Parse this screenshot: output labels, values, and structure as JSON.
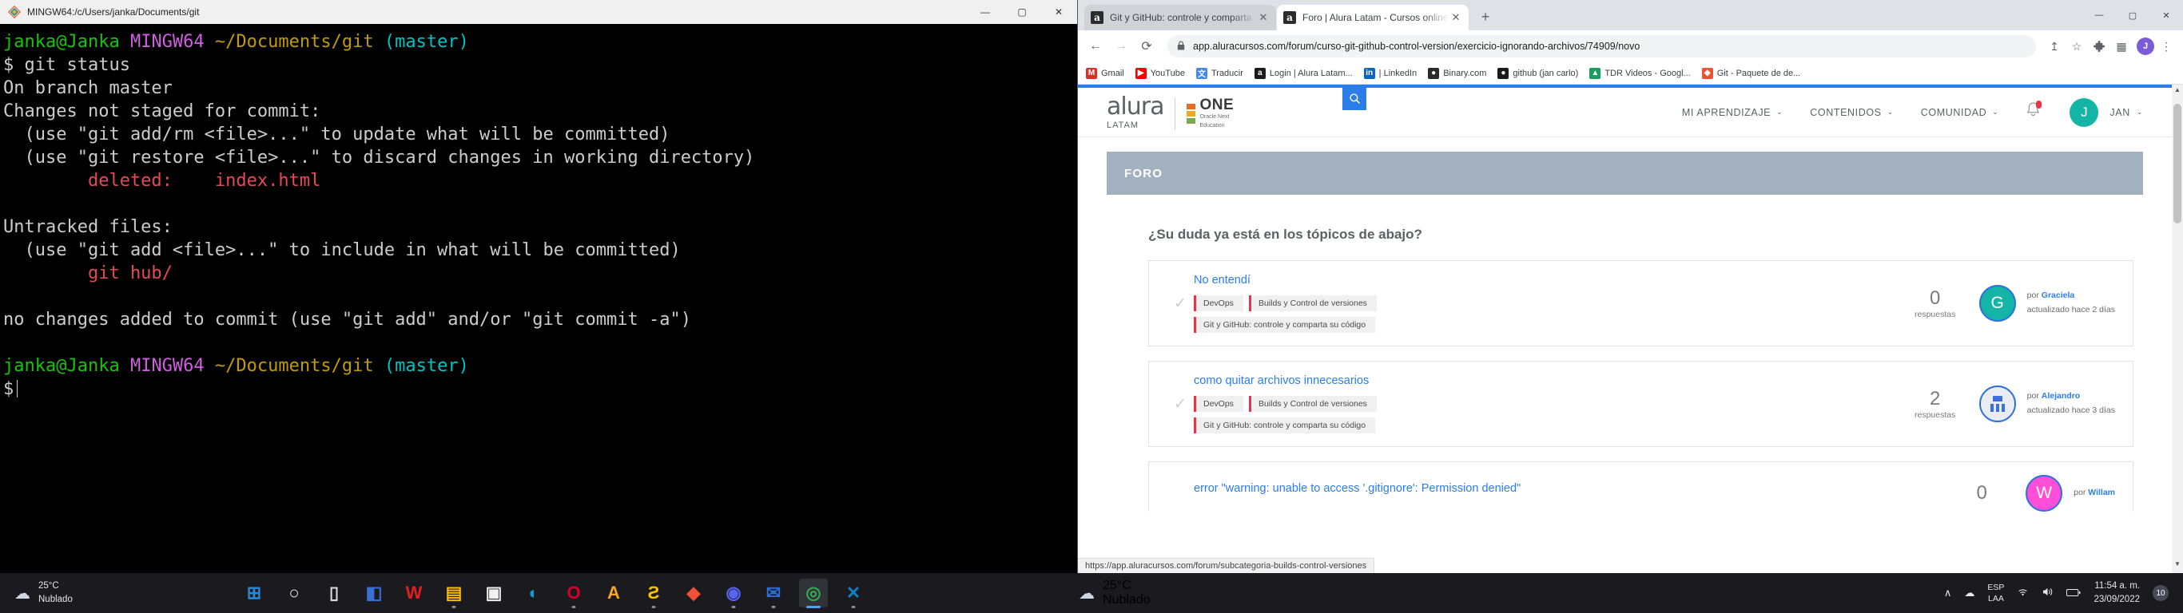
{
  "terminal": {
    "window_title": "MINGW64:/c/Users/janka/Documents/git",
    "controls": {
      "minimize": "—",
      "maximize": "▢",
      "close": "✕"
    },
    "lines": [
      {
        "segments": [
          {
            "text": "janka@Janka",
            "color": "green"
          },
          {
            "text": " MINGW64 ",
            "color": "purple"
          },
          {
            "text": "~/Documents/git",
            "color": "yellow"
          },
          {
            "text": " (master)",
            "color": "cyan"
          }
        ]
      },
      {
        "segments": [
          {
            "text": "$ git status",
            "color": "white"
          }
        ]
      },
      {
        "segments": [
          {
            "text": "On branch master",
            "color": "white"
          }
        ]
      },
      {
        "segments": [
          {
            "text": "Changes not staged for commit:",
            "color": "white"
          }
        ]
      },
      {
        "segments": [
          {
            "text": "  (use \"git add/rm <file>...\" to update what will be committed)",
            "color": "white"
          }
        ]
      },
      {
        "segments": [
          {
            "text": "  (use \"git restore <file>...\" to discard changes in working directory)",
            "color": "white"
          }
        ]
      },
      {
        "segments": [
          {
            "text": "        deleted:    index.html",
            "color": "red"
          }
        ]
      },
      {
        "segments": [
          {
            "text": "",
            "color": "white"
          }
        ]
      },
      {
        "segments": [
          {
            "text": "Untracked files:",
            "color": "white"
          }
        ]
      },
      {
        "segments": [
          {
            "text": "  (use \"git add <file>...\" to include in what will be committed)",
            "color": "white"
          }
        ]
      },
      {
        "segments": [
          {
            "text": "        git hub/",
            "color": "red"
          }
        ]
      },
      {
        "segments": [
          {
            "text": "",
            "color": "white"
          }
        ]
      },
      {
        "segments": [
          {
            "text": "no changes added to commit (use \"git add\" and/or \"git commit -a\")",
            "color": "white"
          }
        ]
      },
      {
        "segments": [
          {
            "text": "",
            "color": "white"
          }
        ]
      },
      {
        "segments": [
          {
            "text": "janka@Janka",
            "color": "green"
          },
          {
            "text": " MINGW64 ",
            "color": "purple"
          },
          {
            "text": "~/Documents/git",
            "color": "yellow"
          },
          {
            "text": " (master)",
            "color": "cyan"
          }
        ]
      },
      {
        "segments": [
          {
            "text": "$",
            "color": "white"
          }
        ],
        "cursor": true
      }
    ]
  },
  "browser": {
    "tabs": [
      {
        "favicon_letter": "a",
        "title": "Git y GitHub: controle y comparta",
        "close": "✕",
        "active": false
      },
      {
        "favicon_letter": "a",
        "title": "Foro | Alura Latam - Cursos online",
        "close": "✕",
        "active": true
      }
    ],
    "new_tab_label": "+",
    "window_controls": {
      "minimize": "—",
      "maximize": "▢",
      "close": "✕"
    },
    "toolbar": {
      "back": "←",
      "forward": "→",
      "reload": "⟳",
      "lock_icon": "lock-icon",
      "url": "app.aluracursos.com/forum/curso-git-github-control-version/exercicio-ignorando-archivos/74909/novo",
      "share_icon": "↥",
      "star_icon": "☆",
      "extensions_icon": "🧩",
      "apps_icon": "▦",
      "profile_letter": "J",
      "menu_icon": "⋮"
    },
    "bookmarks": [
      {
        "label": "Gmail",
        "glyph": "M",
        "color": "#d93025"
      },
      {
        "label": "YouTube",
        "glyph": "▶",
        "color": "#ff0000"
      },
      {
        "label": "Traducir",
        "glyph": "文",
        "color": "#4285f4"
      },
      {
        "label": "Login | Alura Latam...",
        "glyph": "a",
        "color": "#1b1b1b"
      },
      {
        "label": "| LinkedIn",
        "glyph": "in",
        "color": "#0a66c2"
      },
      {
        "label": "Binary.com",
        "glyph": "●",
        "color": "#2a2a2a"
      },
      {
        "label": "github (jan carlo)",
        "glyph": "●",
        "color": "#1b1b1b"
      },
      {
        "label": "TDR Videos - Googl...",
        "glyph": "▲",
        "color": "#1a9e5d"
      },
      {
        "label": "Git - Paquete de de...",
        "glyph": "◆",
        "color": "#f05033"
      }
    ],
    "status_bubble": "https://app.aluracursos.com/forum/subcategoria-builds-control-versiones"
  },
  "alura": {
    "logo": {
      "brand": "alura",
      "region": "LATAM",
      "one": "ONE",
      "one_sub_1": "Oracle Next",
      "one_sub_2": "Education"
    },
    "search_icon": "search-icon",
    "nav": [
      {
        "label": "MI APRENDIZAJE",
        "caret": "⌄"
      },
      {
        "label": "CONTENIDOS",
        "caret": "⌄"
      },
      {
        "label": "COMUNIDAD",
        "caret": "⌄"
      }
    ],
    "notifications_icon": "bell-icon",
    "user": {
      "initial": "J",
      "name": "JAN",
      "caret": "⌄",
      "avatar_color": "#14b5a6"
    },
    "band_title": "FORO",
    "question": "¿Su duda ya está en los tópicos de abajo?",
    "topics": [
      {
        "title": "No entendí",
        "tags": [
          "DevOps",
          "Builds y Control de versiones",
          "Git y GitHub: controle y comparta su código"
        ],
        "replies_count": "0",
        "replies_label": "respuestas",
        "avatar_initial": "G",
        "avatar_color": "#14b5a6",
        "by_label": "por",
        "author": "Graciela",
        "updated": "actualizado hace 2 días"
      },
      {
        "title": "como quitar archivos innecesarios",
        "tags": [
          "DevOps",
          "Builds y Control de versiones",
          "Git y GitHub: controle y comparta su código"
        ],
        "replies_count": "2",
        "replies_label": "respuestas",
        "avatar_initial": "",
        "avatar_color": "#e9ecf2",
        "by_label": "por",
        "author": "Alejandro",
        "updated": "actualizado hace 3 días"
      },
      {
        "title": "error \"warning: unable to access '.gitignore': Permission denied\"",
        "tags": [],
        "replies_count": "0",
        "replies_label": "",
        "avatar_initial": "W",
        "avatar_color": "#ff4fd8",
        "by_label": "por",
        "author": "Willam",
        "updated": ""
      }
    ]
  },
  "taskbar": {
    "weather_left": {
      "temp": "25°C",
      "desc": "Nublado"
    },
    "weather_right": {
      "temp": "25°C",
      "desc": "Nublado"
    },
    "apps": [
      {
        "name": "start-button",
        "glyph": "⊞",
        "color": "#2b88d8"
      },
      {
        "name": "search-button",
        "glyph": "○",
        "color": "#e8e8e8"
      },
      {
        "name": "task-view-button",
        "glyph": "▯",
        "color": "#dcdcdc"
      },
      {
        "name": "widgets-button",
        "glyph": "◧",
        "color": "#3a6fd8"
      },
      {
        "name": "wondershare-app",
        "glyph": "W",
        "color": "#e02020"
      },
      {
        "name": "file-explorer",
        "glyph": "▤",
        "color": "#ffb900"
      },
      {
        "name": "microsoft-store",
        "glyph": "▣",
        "color": "#f2f2f2"
      },
      {
        "name": "microsoft-edge",
        "glyph": "◐",
        "color": "#0f9ed5"
      },
      {
        "name": "opera-browser",
        "glyph": "O",
        "color": "#d6002a"
      },
      {
        "name": "adobe-app",
        "glyph": "A",
        "color": "#f5a623"
      },
      {
        "name": "sublime-text",
        "glyph": "Ƨ",
        "color": "#f7c600"
      },
      {
        "name": "git-bash",
        "glyph": "◆",
        "color": "#f05033"
      },
      {
        "name": "discord-app",
        "glyph": "◉",
        "color": "#5865f2"
      },
      {
        "name": "mail-app",
        "glyph": "✉",
        "color": "#2b6fd8"
      },
      {
        "name": "google-chrome",
        "glyph": "◎",
        "color": "#34a853"
      },
      {
        "name": "vs-code",
        "glyph": "✕",
        "color": "#0f80c1"
      }
    ],
    "tray": {
      "chevron": "∧",
      "cloud": "☁",
      "wifi": "◥",
      "volume": "◀",
      "battery": "▯"
    },
    "language": {
      "line1": "ESP",
      "line2": "LAA"
    },
    "clock": {
      "time": "11:54 a. m.",
      "date": "23/09/2022"
    },
    "notification_badge": "10"
  }
}
